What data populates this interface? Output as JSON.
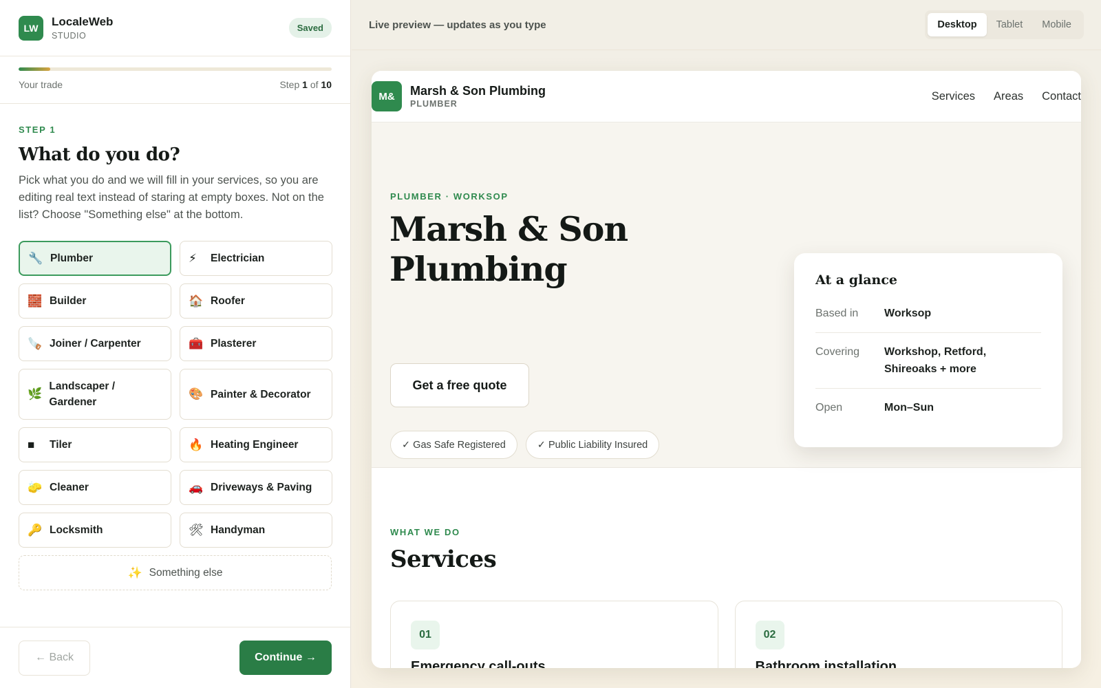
{
  "app": {
    "logo_text": "LW",
    "name": "LocaleWeb",
    "sub": "STUDIO",
    "status": "Saved"
  },
  "progress": {
    "label": "Your trade",
    "step_word": "Step ",
    "current": "1",
    "of_word": " of ",
    "total": "10",
    "fraction": 0.1
  },
  "step": {
    "eyebrow": "STEP 1",
    "title": "What do you do?",
    "description": "Pick what you do and we will fill in your services, so you are editing real text instead of staring at empty boxes. Not on the list? Choose \"Something else\" at the bottom."
  },
  "trades": [
    {
      "icon": "🔧",
      "label": "Plumber",
      "selected": true
    },
    {
      "icon": "⚡",
      "label": "Electrician"
    },
    {
      "icon": "🧱",
      "label": "Builder"
    },
    {
      "icon": "🏠",
      "label": "Roofer"
    },
    {
      "icon": "🪚",
      "label": "Joiner / Carpenter"
    },
    {
      "icon": "🧰",
      "label": "Plasterer"
    },
    {
      "icon": "🌿",
      "label": "Landscaper / Gardener"
    },
    {
      "icon": "🎨",
      "label": "Painter & Decorator"
    },
    {
      "icon": "■",
      "label": "Tiler"
    },
    {
      "icon": "🔥",
      "label": "Heating Engineer"
    },
    {
      "icon": "🧽",
      "label": "Cleaner"
    },
    {
      "icon": "🚗",
      "label": "Driveways & Paving"
    },
    {
      "icon": "🔑",
      "label": "Locksmith"
    },
    {
      "icon": "🛠",
      "label": "Handyman"
    }
  ],
  "something_else": {
    "icon": "✨",
    "label": "Something else"
  },
  "footer": {
    "back_label": "← Back",
    "continue_label": "Continue →"
  },
  "preview_bar": {
    "caption": "Live preview — updates as you type",
    "devices": [
      "Desktop",
      "Tablet",
      "Mobile"
    ],
    "active_device": "Desktop"
  },
  "site": {
    "logo_text": "M&",
    "name": "Marsh & Son Plumbing",
    "sub": "PLUMBER",
    "nav": [
      "Services",
      "Areas",
      "Contact"
    ],
    "hero": {
      "eyebrow": "PLUMBER · WORKSOP",
      "title": "Marsh & Son Plumbing",
      "cta": "Get a free quote",
      "badges": [
        "✓ Gas Safe Registered",
        "✓ Public Liability Insured"
      ]
    },
    "glance": {
      "title": "At a glance",
      "rows": [
        {
          "key": "Based in",
          "value": "Worksop"
        },
        {
          "key": "Covering",
          "value": "Workshop, Retford, Shireoaks + more"
        },
        {
          "key": "Open",
          "value": "Mon–Sun"
        }
      ]
    },
    "services": {
      "eyebrow": "WHAT WE DO",
      "title": "Services",
      "cards": [
        {
          "num": "01",
          "name": "Emergency call-outs"
        },
        {
          "num": "02",
          "name": "Bathroom installation"
        }
      ]
    }
  },
  "colors": {
    "accent": "#2f8a4e",
    "accent_light": "#e9f5ec",
    "progress_end": "#d9a441"
  }
}
